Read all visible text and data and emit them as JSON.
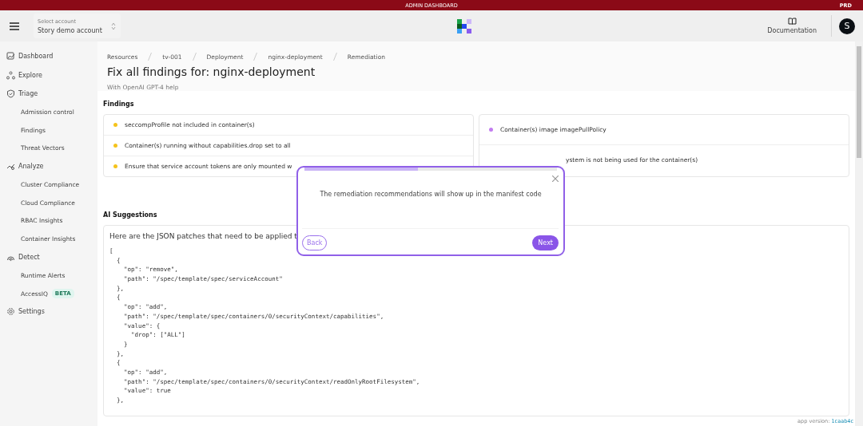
{
  "banner": {
    "title": "ADMIN DASHBOARD",
    "env": "PRD"
  },
  "header": {
    "account_label": "Select account",
    "account": "Story demo account",
    "documentation": "Documentation",
    "avatar": "S"
  },
  "sidebar": {
    "items": [
      {
        "kind": "dashboard",
        "label": "Dashboard"
      },
      {
        "kind": "explore",
        "label": "Explore"
      },
      {
        "kind": "triage",
        "label": "Triage"
      },
      {
        "kind": "sub",
        "label": "Admission control"
      },
      {
        "kind": "sub",
        "label": "Findings"
      },
      {
        "kind": "sub",
        "label": "Threat Vectors"
      },
      {
        "kind": "analyze",
        "label": "Analyze"
      },
      {
        "kind": "sub",
        "label": "Cluster Compliance"
      },
      {
        "kind": "sub",
        "label": "Cloud Compliance"
      },
      {
        "kind": "sub",
        "label": "RBAC Insights"
      },
      {
        "kind": "sub",
        "label": "Container Insights"
      },
      {
        "kind": "detect",
        "label": "Detect"
      },
      {
        "kind": "sub",
        "label": "Runtime Alerts"
      },
      {
        "kind": "sub",
        "label": "AccessIQ",
        "badge": "BETA"
      },
      {
        "kind": "settings",
        "label": "Settings"
      }
    ]
  },
  "breadcrumbs": [
    "Resources",
    "tv-001",
    "Deployment",
    "nginx-deployment",
    "Remediation"
  ],
  "page": {
    "title": "Fix all findings for: nginx-deployment",
    "subtitle": "With OpenAI GPT-4 help"
  },
  "findings": {
    "title": "Findings",
    "columns": [
      [
        {
          "text": "seccompProfile not included in container(s)",
          "color": "#f5c31c"
        },
        {
          "text": "Container(s) running without capabilities.drop set to all",
          "color": "#f5c31c"
        },
        {
          "text": "Ensure that service account tokens are only mounted w",
          "color": "#f5c31c"
        }
      ],
      [
        {
          "text": "Container(s) image imagePullPolicy",
          "color": "#c27cf0"
        },
        {
          "text": "ystem is not being used for the container(s)"
        }
      ]
    ]
  },
  "suggestions": {
    "title": "AI Suggestions",
    "intro": "Here are the JSON patches that need to be applied t",
    "code": [
      "[",
      "  {",
      "    \"op\": \"remove\",",
      "    \"path\": \"/spec/template/spec/serviceAccount\"",
      "  },",
      "  {",
      "    \"op\": \"add\",",
      "    \"path\": \"/spec/template/spec/containers/0/securityContext/capabilities\",",
      "    \"value\": {",
      "      \"drop\": [\"ALL\"]",
      "    }",
      "  },",
      "  {",
      "    \"op\": \"add\",",
      "    \"path\": \"/spec/template/spec/containers/0/securityContext/readOnlyRootFilesystem\",",
      "    \"value\": true",
      "  },"
    ]
  },
  "popover": {
    "text": "The remediation recommendations will show up in the manifest code",
    "level": 0.45,
    "back": "Back",
    "next": "Next"
  },
  "footer": {
    "label": "app version:",
    "version": "1caab4c"
  }
}
